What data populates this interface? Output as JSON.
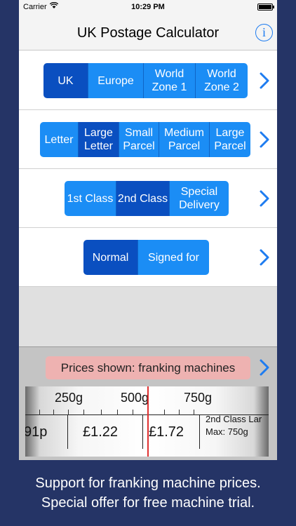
{
  "status_bar": {
    "carrier": "Carrier",
    "time": "10:29 PM",
    "wifi_icon": "wifi-icon",
    "battery_icon": "battery-icon"
  },
  "nav": {
    "title": "UK Postage Calculator",
    "info_icon_glyph": "i"
  },
  "destination": {
    "options": [
      {
        "label": "UK",
        "selected": true
      },
      {
        "label": "Europe",
        "selected": false
      },
      {
        "label": "World Zone 1",
        "selected": false
      },
      {
        "label": "World Zone 2",
        "selected": false
      }
    ]
  },
  "format": {
    "options": [
      {
        "label": "Letter",
        "selected": false
      },
      {
        "label": "Large Letter",
        "selected": true
      },
      {
        "label": "Small Parcel",
        "selected": false
      },
      {
        "label": "Medium Parcel",
        "selected": false
      },
      {
        "label": "Large Parcel",
        "selected": false
      }
    ]
  },
  "service_class": {
    "options": [
      {
        "label": "1st Class",
        "selected": false
      },
      {
        "label": "2nd Class",
        "selected": true
      },
      {
        "label": "Special Delivery",
        "selected": false
      }
    ]
  },
  "delivery": {
    "options": [
      {
        "label": "Normal",
        "selected": true
      },
      {
        "label": "Signed for",
        "selected": false
      }
    ]
  },
  "prices": {
    "shown_label": "Prices shown: franking machines",
    "weights": [
      "250g",
      "500g",
      "750g"
    ],
    "values": [
      "91p",
      "£1.22",
      "£1.72"
    ],
    "service_name": "2nd Class Lar",
    "max_weight": "Max: 750g"
  },
  "colors": {
    "accent": "#1b8df5",
    "selected": "#0a4fc0",
    "background": "#253466",
    "price_label": "#eeb2b1",
    "needle": "#e03030"
  },
  "caption": {
    "line1": "Support for franking machine prices.",
    "line2": "Special offer for free machine trial."
  }
}
